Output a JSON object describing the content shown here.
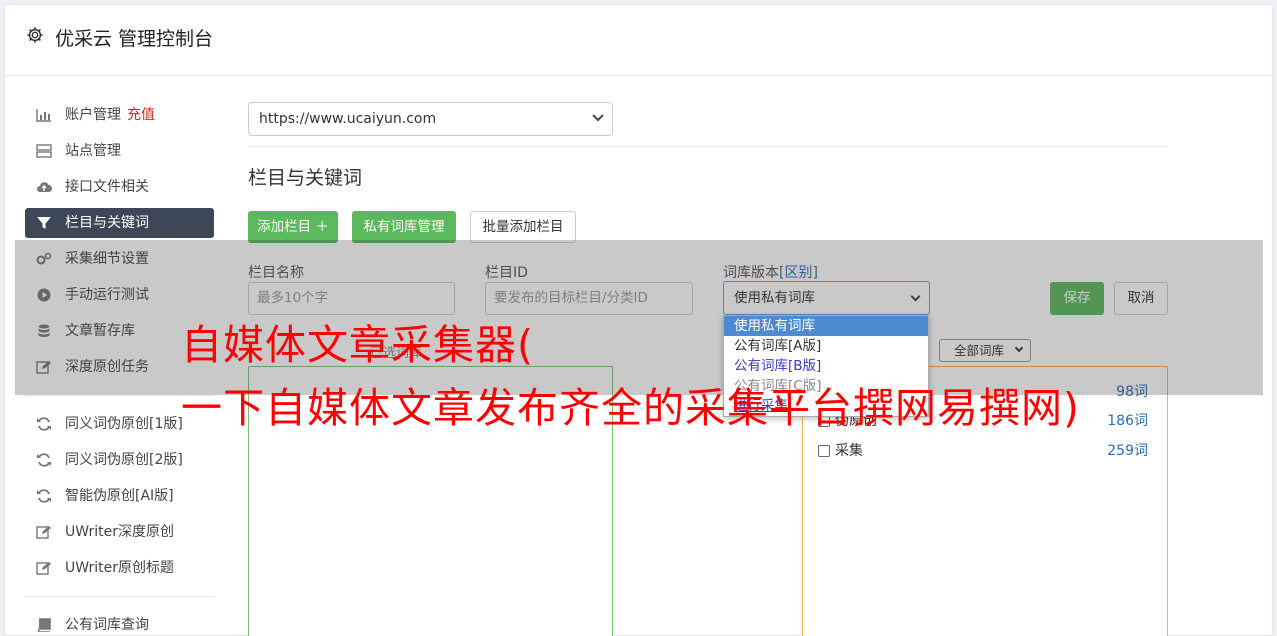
{
  "header": {
    "title": "优采云 管理控制台"
  },
  "sidebar": {
    "items": [
      {
        "label": "账户管理",
        "extra": "充值"
      },
      {
        "label": "站点管理"
      },
      {
        "label": "接口文件相关"
      },
      {
        "label": "栏目与关键词"
      },
      {
        "label": "采集细节设置"
      },
      {
        "label": "手动运行测试"
      },
      {
        "label": "文章暂存库"
      },
      {
        "label": "深度原创任务"
      },
      {
        "label": "同义词伪原创[1版]"
      },
      {
        "label": "同义词伪原创[2版]"
      },
      {
        "label": "智能伪原创[AI版]"
      },
      {
        "label": "UWriter深度原创"
      },
      {
        "label": "UWriter原创标题"
      },
      {
        "label": "公有词库查询"
      }
    ]
  },
  "main": {
    "site_select": "https://www.ucaiyun.com",
    "section_title": "栏目与关键词",
    "btn_add": "添加栏目 ＋",
    "btn_private": "私有词库管理",
    "btn_batch": "批量添加栏目",
    "form": {
      "name_label": "栏目名称",
      "name_placeholder": "最多10个字",
      "id_label": "栏目ID",
      "id_placeholder": "要发布的目标栏目/分类ID",
      "ver_label": "词库版本",
      "ver_diff": "[区别]",
      "ver_value": "使用私有词库",
      "save": "保存",
      "cancel": "取消"
    },
    "dropdown": [
      "使用私有词库",
      "公有词库[A版]",
      "公有词库[B版]",
      "公有词库[C版]",
      "进行采集"
    ],
    "keyword_label": "已选词库",
    "all_lib": "全部词库",
    "libs": [
      {
        "name": "",
        "count": "98词"
      },
      {
        "name": "伪原创",
        "count": "186词"
      },
      {
        "name": "采集",
        "count": "259词"
      }
    ]
  },
  "watermark": {
    "line1": "自媒体文章采集器(",
    "line2": "一下自媒体文章发布齐全的采集平台撰网易撰网)"
  },
  "colors": {
    "accent_green": "#5cb85c",
    "sidebar_active": "#3c4858",
    "watermark": "#ff0000"
  }
}
